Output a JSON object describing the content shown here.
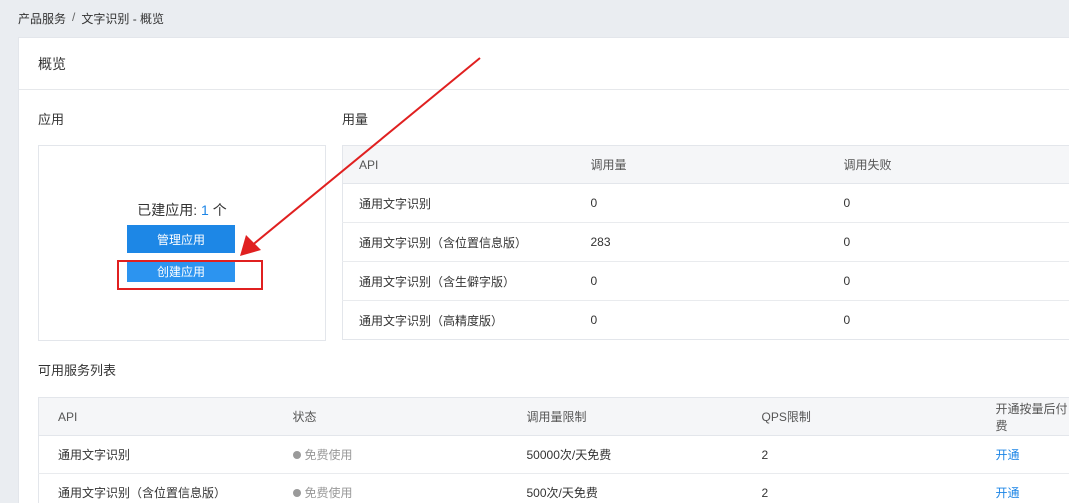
{
  "breadcrumb": {
    "root": "产品服务",
    "separator": "/",
    "current": "文字识别 - 概览"
  },
  "card": {
    "title": "概览"
  },
  "apps": {
    "section_title": "应用",
    "count_label": "已建应用:",
    "count": "1",
    "count_unit": "个",
    "manage_label": "管理应用",
    "create_label": "创建应用"
  },
  "usage": {
    "section_title": "用量",
    "headers": [
      "API",
      "调用量",
      "调用失败"
    ],
    "rows": [
      [
        "通用文字识别",
        "0",
        "0"
      ],
      [
        "通用文字识别（含位置信息版）",
        "283",
        "0"
      ],
      [
        "通用文字识别（含生僻字版）",
        "0",
        "0"
      ],
      [
        "通用文字识别（高精度版）",
        "0",
        "0"
      ]
    ]
  },
  "services": {
    "section_title": "可用服务列表",
    "headers": [
      "API",
      "状态",
      "调用量限制",
      "QPS限制",
      "开通按量后付费"
    ],
    "rows": [
      {
        "api": "通用文字识别",
        "status": "免费使用",
        "limit": "50000次/天免费",
        "qps": "2",
        "action": "开通"
      },
      {
        "api": "通用文字识别（含位置信息版）",
        "status": "免费使用",
        "limit": "500次/天免费",
        "qps": "2",
        "action": "开通"
      }
    ]
  },
  "colors": {
    "accent": "#1890ff",
    "annotation": "#e02020",
    "link": "#1c85e6"
  }
}
